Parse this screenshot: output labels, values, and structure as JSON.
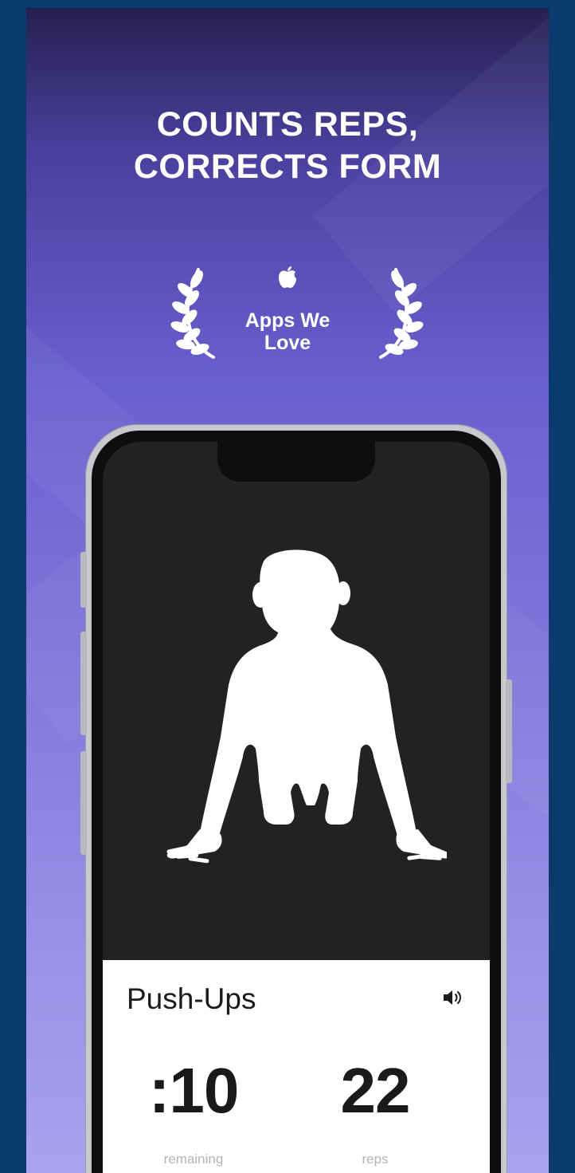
{
  "headline": {
    "line1": "COUNTS REPS,",
    "line2": "CORRECTS FORM"
  },
  "award": {
    "icon": "apple-icon",
    "line1": "Apps We",
    "line2": "Love"
  },
  "workout": {
    "exercise_name": "Push-Ups",
    "sound_icon": "speaker-icon",
    "time_value": ":10",
    "time_label": "remaining",
    "reps_value": "22",
    "reps_label": "reps"
  },
  "colors": {
    "page_background": "#0b3a6e",
    "gradient_top": "#262050",
    "gradient_bottom": "#a8a2ef",
    "screen_background": "#222222",
    "panel_background": "#ffffff"
  }
}
